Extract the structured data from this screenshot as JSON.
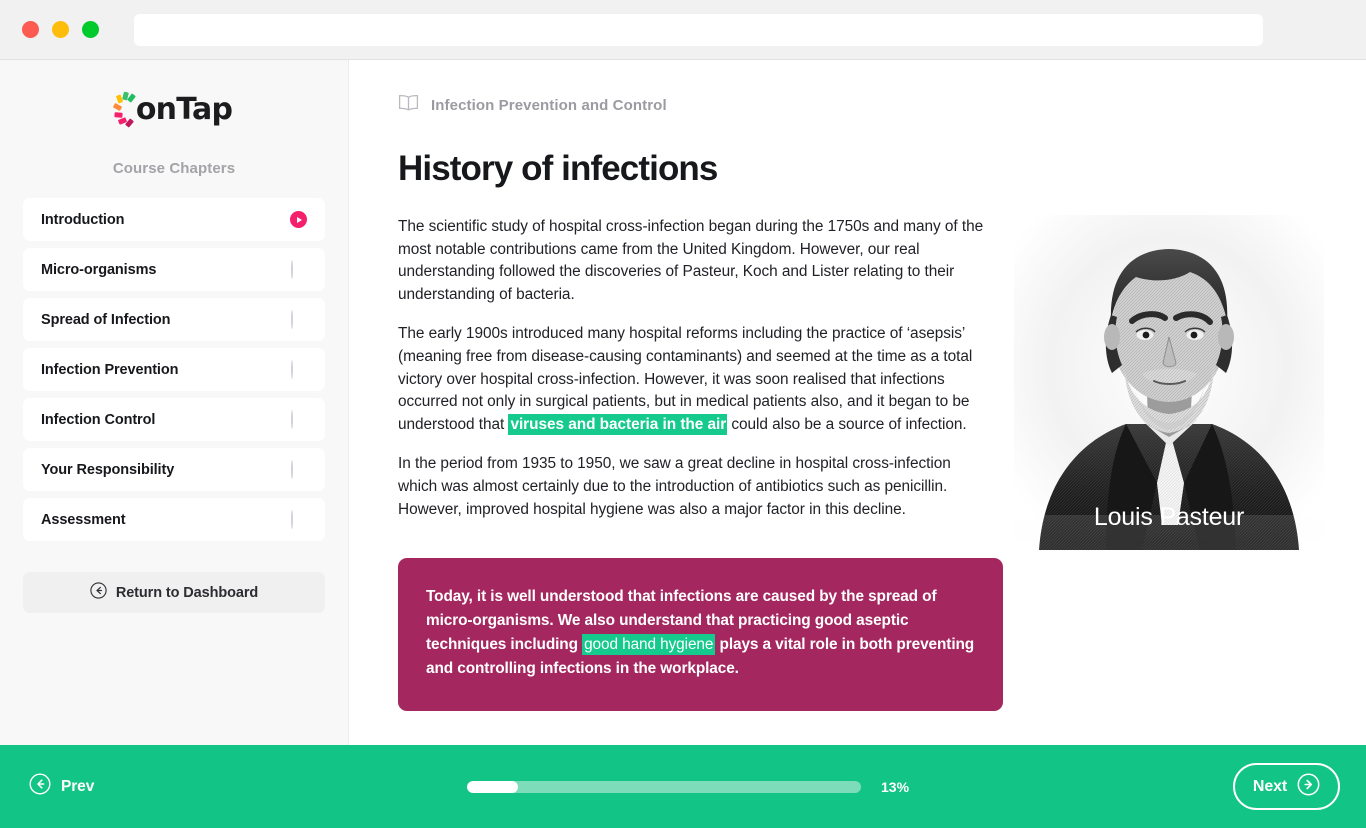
{
  "window": {
    "traffic_lights": [
      "close",
      "minimize",
      "maximize"
    ],
    "url_value": "",
    "url_placeholder": ""
  },
  "sidebar": {
    "logo_text": "onTap",
    "logo_arc_colors": [
      "#f5206b",
      "#f5206b",
      "#ff8a3d",
      "#ffc107",
      "#3ac06b",
      "#1fbf5e",
      "#16c98d"
    ],
    "chapters_heading": "Course Chapters",
    "items": [
      {
        "label": "Introduction",
        "status": "playing"
      },
      {
        "label": "Micro-organisms",
        "status": "empty"
      },
      {
        "label": "Spread of Infection",
        "status": "empty"
      },
      {
        "label": "Infection Prevention",
        "status": "empty"
      },
      {
        "label": "Infection Control",
        "status": "empty"
      },
      {
        "label": "Your Responsibility",
        "status": "empty"
      },
      {
        "label": "Assessment",
        "status": "empty"
      }
    ],
    "return_label": "Return to Dashboard"
  },
  "main": {
    "breadcrumb": "Infection Prevention and Control",
    "title": "History of infections",
    "paragraphs": [
      {
        "segments": [
          {
            "text": "The scientific study of hospital cross-infection began during the 1750s and many of the most notable contributions came from the United Kingdom. However, our real understanding followed the discoveries of Pasteur, Koch and Lister relating to their understanding of bacteria.",
            "highlight": false
          }
        ]
      },
      {
        "segments": [
          {
            "text": "The early 1900s introduced many hospital reforms including the practice of ‘asepsis’ (meaning free from disease-causing contaminants) and seemed at the time as a total victory over hospital cross-infection. However, it was soon realised that infections occurred not only in surgical patients, but in medical patients also, and it began to be understood that ",
            "highlight": false
          },
          {
            "text": "viruses and bacteria in the air",
            "highlight": true
          },
          {
            "text": " could also be a source of infection.",
            "highlight": false
          }
        ]
      },
      {
        "segments": [
          {
            "text": "In the period from 1935 to 1950, we saw a great decline in hospital cross-infection which was almost certainly due to the introduction of antibiotics such as penicillin. However, improved hospital hygiene was also a major factor in this decline.",
            "highlight": false
          }
        ]
      }
    ],
    "callout": {
      "segments": [
        {
          "text": "Today, it is well understood that infections are caused by the spread of micro-organisms. We also understand that practicing good aseptic techniques including ",
          "highlight": false
        },
        {
          "text": "good hand hygiene",
          "highlight": true
        },
        {
          "text": " plays a vital role in both preventing and controlling infections in the workplace.",
          "highlight": false
        }
      ],
      "background_color": "#a5275f"
    },
    "portrait_caption": "Louis Pasteur"
  },
  "bottombar": {
    "prev_label": "Prev",
    "next_label": "Next",
    "progress_percent": 13,
    "progress_label": "13%",
    "bar_color": "#12c486",
    "track_color": "#7ddcb9"
  },
  "colors": {
    "accent_green": "#12c486",
    "highlight_green": "#16c98d",
    "accent_pink": "#f5206b",
    "callout_magenta": "#a5275f"
  }
}
